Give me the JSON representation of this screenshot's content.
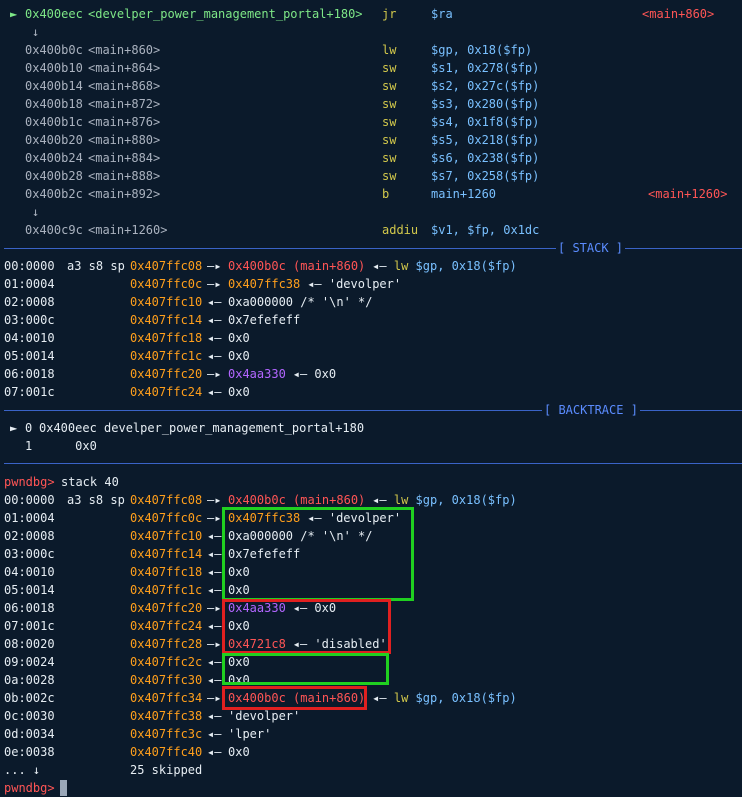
{
  "disasm": [
    {
      "marker": "►",
      "addr": "0x400eec",
      "sym": "<develper_power_management_portal+180>",
      "op": "jr",
      "args": "$ra",
      "target": "<main+860>",
      "current": true
    },
    {
      "arrow": "↓"
    },
    {
      "addr": "0x400b0c",
      "sym": "<main+860>",
      "op": "lw",
      "args": "$gp, 0x18($fp)"
    },
    {
      "addr": "0x400b10",
      "sym": "<main+864>",
      "op": "sw",
      "args": "$s1, 0x278($fp)"
    },
    {
      "addr": "0x400b14",
      "sym": "<main+868>",
      "op": "sw",
      "args": "$s2, 0x27c($fp)"
    },
    {
      "addr": "0x400b18",
      "sym": "<main+872>",
      "op": "sw",
      "args": "$s3, 0x280($fp)"
    },
    {
      "addr": "0x400b1c",
      "sym": "<main+876>",
      "op": "sw",
      "args": "$s4, 0x1f8($fp)"
    },
    {
      "addr": "0x400b20",
      "sym": "<main+880>",
      "op": "sw",
      "args": "$s5, 0x218($fp)"
    },
    {
      "addr": "0x400b24",
      "sym": "<main+884>",
      "op": "sw",
      "args": "$s6, 0x238($fp)"
    },
    {
      "addr": "0x400b28",
      "sym": "<main+888>",
      "op": "sw",
      "args": "$s7, 0x258($fp)"
    },
    {
      "addr": "0x400b2c",
      "sym": "<main+892>",
      "op": "b",
      "args": "main+1260",
      "target": "<main+1260>"
    },
    {
      "arrow": "↓"
    },
    {
      "addr": "0x400c9c",
      "sym": "<main+1260>",
      "op": "addiu",
      "args": "$v1, $fp, 0x1dc"
    }
  ],
  "stack_title": "[ STACK ]",
  "stack": [
    {
      "idx": "00:0000",
      "regs": "a3 s8 sp",
      "addr": "0x407ffc08",
      "arrow": "—▸",
      "v1": "0x400b0c (main+860)",
      "v1c": "red",
      "rest": "◂— lw $gp, 0x18($fp)"
    },
    {
      "idx": "01:0004",
      "addr": "0x407ffc0c",
      "arrow": "—▸",
      "v1": "0x407ffc38",
      "v1c": "orange",
      "rest": "◂— 'devolper'"
    },
    {
      "idx": "02:0008",
      "addr": "0x407ffc10",
      "arrow": "◂—",
      "v1": "0xa000000 /* '\\n' */",
      "v1c": "white"
    },
    {
      "idx": "03:000c",
      "addr": "0x407ffc14",
      "arrow": "◂—",
      "v1": "0x7efefeff",
      "v1c": "white"
    },
    {
      "idx": "04:0010",
      "addr": "0x407ffc18",
      "arrow": "◂—",
      "v1": "0x0",
      "v1c": "white"
    },
    {
      "idx": "05:0014",
      "addr": "0x407ffc1c",
      "arrow": "◂—",
      "v1": "0x0",
      "v1c": "white"
    },
    {
      "idx": "06:0018",
      "addr": "0x407ffc20",
      "arrow": "—▸",
      "v1": "0x4aa330",
      "v1c": "purple",
      "rest": "◂— 0x0"
    },
    {
      "idx": "07:001c",
      "addr": "0x407ffc24",
      "arrow": "◂—",
      "v1": "0x0",
      "v1c": "white"
    }
  ],
  "backtrace_title": "[ BACKTRACE ]",
  "backtrace": [
    {
      "marker": "►",
      "num": "0",
      "text": "0x400eec develper_power_management_portal+180"
    },
    {
      "num": "1",
      "text": "     0x0"
    }
  ],
  "prompt": "pwndbg>",
  "command": "stack 40",
  "stack2": [
    {
      "idx": "00:0000",
      "regs": "a3 s8 sp",
      "addr": "0x407ffc08",
      "arrow": "—▸",
      "v1": "0x400b0c (main+860)",
      "v1c": "red",
      "rest": "◂— lw $gp, 0x18($fp)"
    },
    {
      "idx": "01:0004",
      "addr": "0x407ffc0c",
      "arrow": "—▸",
      "v1": "0x407ffc38",
      "v1c": "orange",
      "rest": "◂— 'devolper'"
    },
    {
      "idx": "02:0008",
      "addr": "0x407ffc10",
      "arrow": "◂—",
      "v1": "0xa000000 /* '\\n' */",
      "v1c": "white"
    },
    {
      "idx": "03:000c",
      "addr": "0x407ffc14",
      "arrow": "◂—",
      "v1": "0x7efefeff",
      "v1c": "white"
    },
    {
      "idx": "04:0010",
      "addr": "0x407ffc18",
      "arrow": "◂—",
      "v1": "0x0",
      "v1c": "white"
    },
    {
      "idx": "05:0014",
      "addr": "0x407ffc1c",
      "arrow": "◂—",
      "v1": "0x0",
      "v1c": "white"
    },
    {
      "idx": "06:0018",
      "addr": "0x407ffc20",
      "arrow": "—▸",
      "v1": "0x4aa330",
      "v1c": "purple",
      "rest": "◂— 0x0"
    },
    {
      "idx": "07:001c",
      "addr": "0x407ffc24",
      "arrow": "◂—",
      "v1": "0x0",
      "v1c": "white"
    },
    {
      "idx": "08:0020",
      "addr": "0x407ffc28",
      "arrow": "—▸",
      "v1": "0x4721c8",
      "v1c": "red",
      "rest": "◂— 'disabled'"
    },
    {
      "idx": "09:0024",
      "addr": "0x407ffc2c",
      "arrow": "◂—",
      "v1": "0x0",
      "v1c": "white"
    },
    {
      "idx": "0a:0028",
      "addr": "0x407ffc30",
      "arrow": "◂—",
      "v1": "0x0",
      "v1c": "white"
    },
    {
      "idx": "0b:002c",
      "addr": "0x407ffc34",
      "arrow": "—▸",
      "v1": "0x400b0c (main+860)",
      "v1c": "red",
      "rest": "◂— lw $gp, 0x18($fp)"
    },
    {
      "idx": "0c:0030",
      "addr": "0x407ffc38",
      "arrow": "◂—",
      "v1": "'devolper'",
      "v1c": "white"
    },
    {
      "idx": "0d:0034",
      "addr": "0x407ffc3c",
      "arrow": "◂—",
      "v1": "'lper'",
      "v1c": "white"
    },
    {
      "idx": "0e:0038",
      "addr": "0x407ffc40",
      "arrow": "◂—",
      "v1": "0x0",
      "v1c": "white"
    }
  ],
  "skipped": {
    "idx": "... ↓",
    "text": "25 skipped"
  },
  "colors": {
    "bg": "#0b1a2b",
    "green_box": "#20d020",
    "red_box": "#e02020",
    "rule": "#3a63c7"
  }
}
